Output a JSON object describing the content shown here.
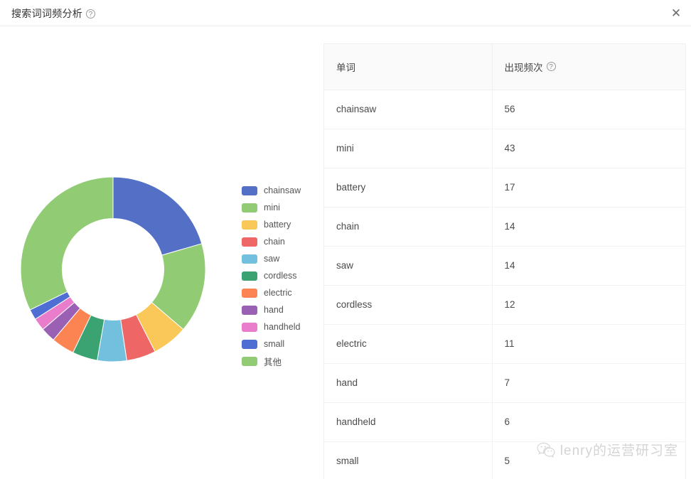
{
  "header": {
    "title": "搜索词词频分析",
    "help_icon": "question-circle-icon",
    "close_label": "✕"
  },
  "table": {
    "columns": [
      {
        "key": "word",
        "label": "单词"
      },
      {
        "key": "freq",
        "label": "出现频次",
        "help_icon": "question-circle-icon"
      }
    ],
    "rows": [
      {
        "word": "chainsaw",
        "freq": "56"
      },
      {
        "word": "mini",
        "freq": "43"
      },
      {
        "word": "battery",
        "freq": "17"
      },
      {
        "word": "chain",
        "freq": "14"
      },
      {
        "word": "saw",
        "freq": "14"
      },
      {
        "word": "cordless",
        "freq": "12"
      },
      {
        "word": "electric",
        "freq": "11"
      },
      {
        "word": "hand",
        "freq": "7"
      },
      {
        "word": "handheld",
        "freq": "6"
      },
      {
        "word": "small",
        "freq": "5"
      }
    ]
  },
  "watermark": {
    "text": "lenry的运营研习室",
    "icon": "wechat-icon"
  },
  "chart_data": {
    "type": "pie",
    "variant": "donut",
    "title": "搜索词词频分析",
    "legend_position": "right",
    "start_angle": 90,
    "direction": "clockwise",
    "inner_radius_ratio": 0.55,
    "categories": [
      "chainsaw",
      "mini",
      "battery",
      "chain",
      "saw",
      "cordless",
      "electric",
      "hand",
      "handheld",
      "small",
      "其他"
    ],
    "values": [
      56,
      43,
      17,
      14,
      14,
      12,
      11,
      7,
      6,
      5,
      88
    ],
    "colors": [
      "#5470c6",
      "#91cc75",
      "#fac858",
      "#ee6666",
      "#73c0de",
      "#3ba272",
      "#fc8452",
      "#9a60b4",
      "#ea7ccc",
      "#4e6ed3",
      "#91cc75"
    ],
    "total": 273
  }
}
